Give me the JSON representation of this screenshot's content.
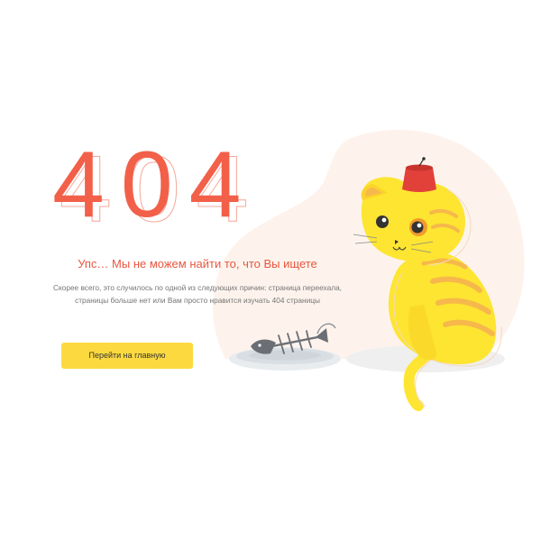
{
  "error": {
    "code": "404",
    "headline": "Упс… Мы не можем найти то, что Вы ищете",
    "description_lines": [
      "Скорее всего, это случилось по одной из следующих причин: страница переехала,",
      "страницы больше нет или Вам просто нравится изучать 404 страницы"
    ]
  },
  "actions": {
    "home_button_label": "Перейти на главную"
  },
  "illustration": {
    "icons": [
      "cat-icon",
      "fez-hat-icon",
      "fish-bone-icon",
      "plate-icon"
    ]
  },
  "colors": {
    "accent_red": "#f26049",
    "button_yellow": "#fcda3f",
    "cat_yellow": "#fde532",
    "cat_stripes": "#f6b84b",
    "background_blob": "#fdf3ec"
  }
}
